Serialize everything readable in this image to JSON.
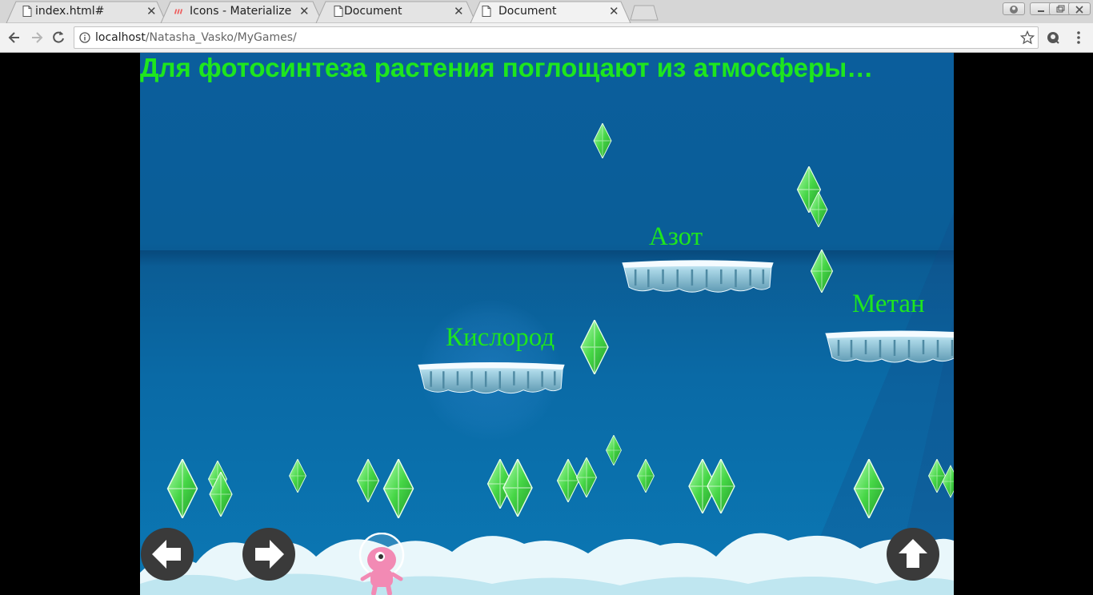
{
  "browser": {
    "tabs": [
      {
        "title": "index.html#",
        "active": false,
        "icon": "document-icon"
      },
      {
        "title": "Icons - Materialize",
        "active": false,
        "icon": "materialize-icon"
      },
      {
        "title": "Document",
        "active": false,
        "icon": "document-icon"
      },
      {
        "title": "Document",
        "active": true,
        "icon": "document-icon"
      }
    ],
    "address": {
      "host": "localhost",
      "path": "/Natasha_Vasko/MyGames/"
    }
  },
  "game": {
    "question": "Для фотосинтеза растения поглощают из атмосферы…",
    "answers": [
      {
        "label": "Азот"
      },
      {
        "label": "Метан"
      },
      {
        "label": "Кислород"
      }
    ],
    "controls": {
      "left": "arrow-left-icon",
      "right": "arrow-right-icon",
      "jump": "arrow-up-icon"
    },
    "player": "pink-alien-character",
    "colors": {
      "question_text": "#1ee61e",
      "answer_text": "#1ee61e",
      "gem": "#4fd84f",
      "background": "#0b5e9c"
    }
  }
}
